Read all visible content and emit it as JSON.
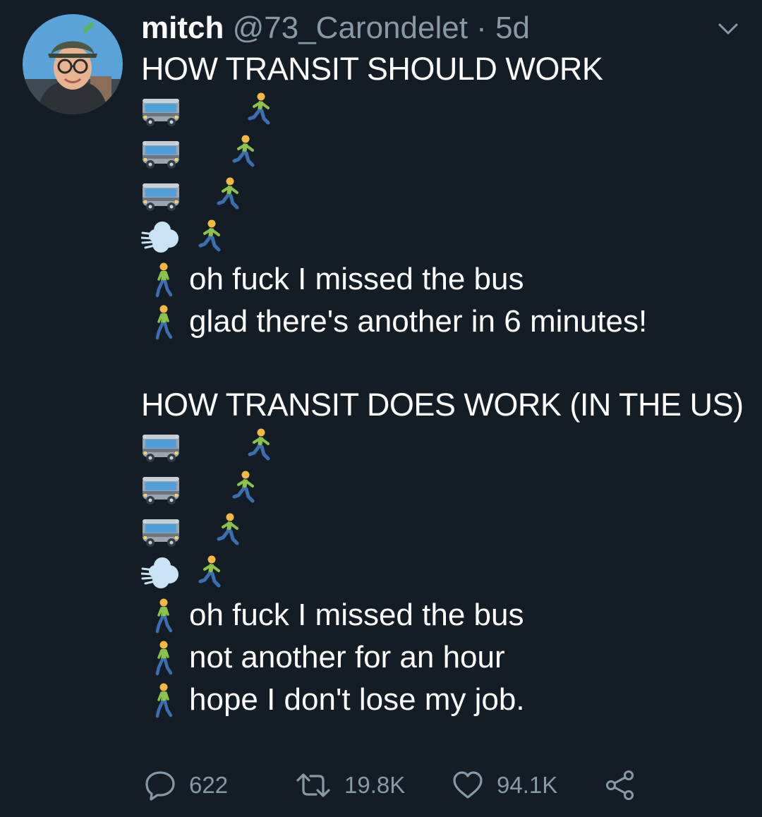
{
  "tweet": {
    "author": {
      "display_name": "mitch",
      "handle": "@73_Carondelet",
      "separator": "·",
      "time": "5d"
    },
    "sections": [
      {
        "heading": "HOW TRANSIT SHOULD WORK",
        "lines": [
          "oh fuck I missed the bus",
          "glad there's another in 6 minutes!"
        ]
      },
      {
        "heading": "HOW TRANSIT DOES WORK (IN THE US)",
        "lines": [
          "oh fuck I missed the bus",
          "not another for an hour",
          "hope I don't lose my job."
        ]
      }
    ],
    "emoji_sequence": [
      "bus",
      "bus",
      "bus",
      "dash-puff",
      "runner",
      "walker"
    ]
  },
  "actions": {
    "replies": "622",
    "retweets": "19.8K",
    "likes": "94.1K"
  },
  "colors": {
    "background": "#141d26",
    "text": "#ffffff",
    "muted": "#8899a6"
  }
}
